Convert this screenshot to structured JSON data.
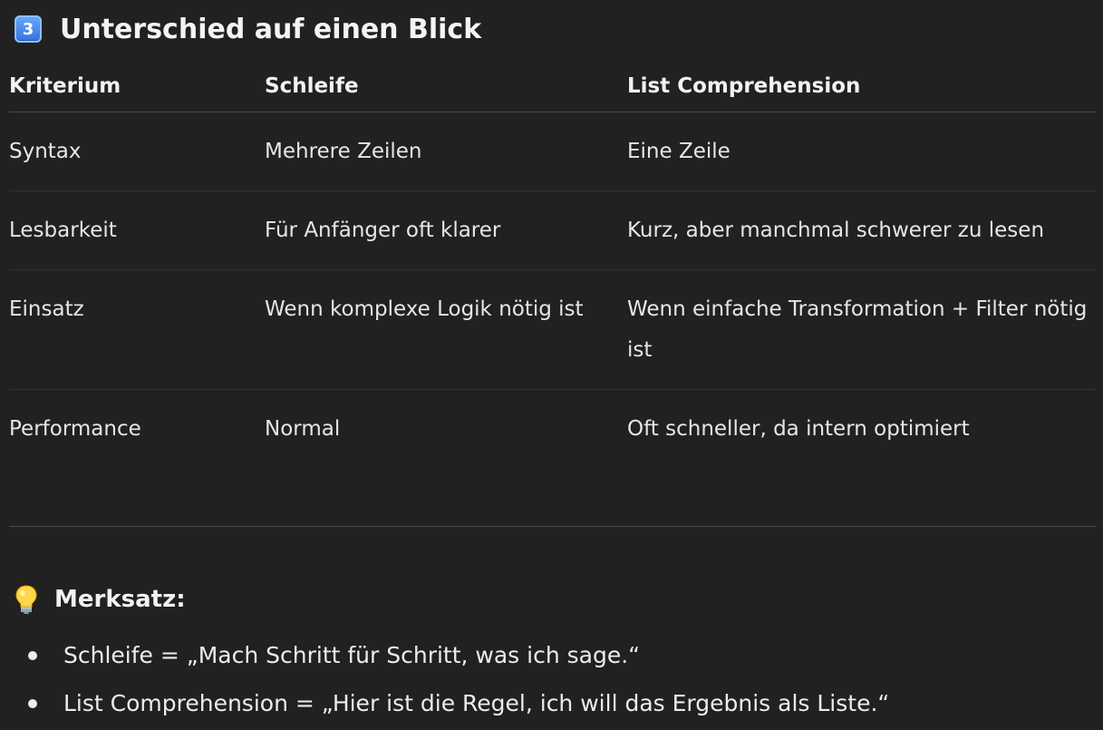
{
  "section": {
    "badge": "3",
    "title": "Unterschied auf einen Blick"
  },
  "table": {
    "headers": [
      "Kriterium",
      "Schleife",
      "List Comprehension"
    ],
    "rows": [
      [
        "Syntax",
        "Mehrere Zeilen",
        "Eine Zeile"
      ],
      [
        "Lesbarkeit",
        "Für Anfänger oft klarer",
        "Kurz, aber manchmal schwerer zu lesen"
      ],
      [
        "Einsatz",
        "Wenn komplexe Logik nötig ist",
        "Wenn einfache Transformation + Filter nötig ist"
      ],
      [
        "Performance",
        "Normal",
        "Oft schneller, da intern optimiert"
      ]
    ]
  },
  "merksatz": {
    "icon": "lightbulb-icon",
    "title": "Merksatz:",
    "items": [
      "Schleife = „Mach Schritt für Schritt, was ich sage.“",
      "List Comprehension = „Hier ist die Regel, ich will das Ergebnis als Liste.“"
    ]
  },
  "colors": {
    "background": "#212121",
    "text": "#ececec",
    "keycap": "#2f73d9"
  }
}
